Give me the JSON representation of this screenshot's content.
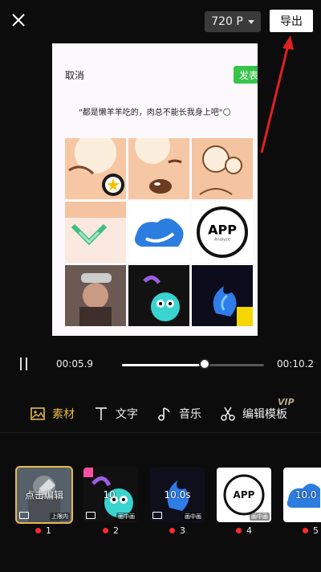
{
  "topbar": {
    "quality_label": "720 P",
    "export_label": "导出"
  },
  "preview": {
    "cancel_label": "取消",
    "post_label": "发表",
    "caption": "\"都是懒羊羊吃的，肉总不能长我身上吧\"🌕",
    "grid_app_text": "APP",
    "grid_app_subtext": "Analyze"
  },
  "player": {
    "current_time": "00:05.9",
    "total_time": "00:10.2",
    "progress": 0.58
  },
  "toolbar": {
    "items": [
      {
        "label": "素材",
        "icon": "image-icon",
        "active": true
      },
      {
        "label": "文字",
        "icon": "text-icon",
        "active": false
      },
      {
        "label": "音乐",
        "icon": "music-icon",
        "active": false
      },
      {
        "label": "编辑模板",
        "icon": "scissors-icon",
        "active": false
      }
    ],
    "vip_badge": "VIP"
  },
  "clips": [
    {
      "number": "1",
      "center_label": "点击编辑",
      "tag": "上限内"
    },
    {
      "number": "2",
      "center_label": "10.",
      "tag": "画中画"
    },
    {
      "number": "3",
      "center_label": "10.0s",
      "tag": "画中画"
    },
    {
      "number": "4",
      "center_label": "APP",
      "tag": "画中画"
    },
    {
      "number": "5",
      "center_label": "10.0",
      "tag": ""
    }
  ],
  "colors": {
    "accent": "#e9b84a",
    "post_green": "#37c44a",
    "dot_red": "#ff2b2b",
    "arrow_red": "#e02020"
  }
}
